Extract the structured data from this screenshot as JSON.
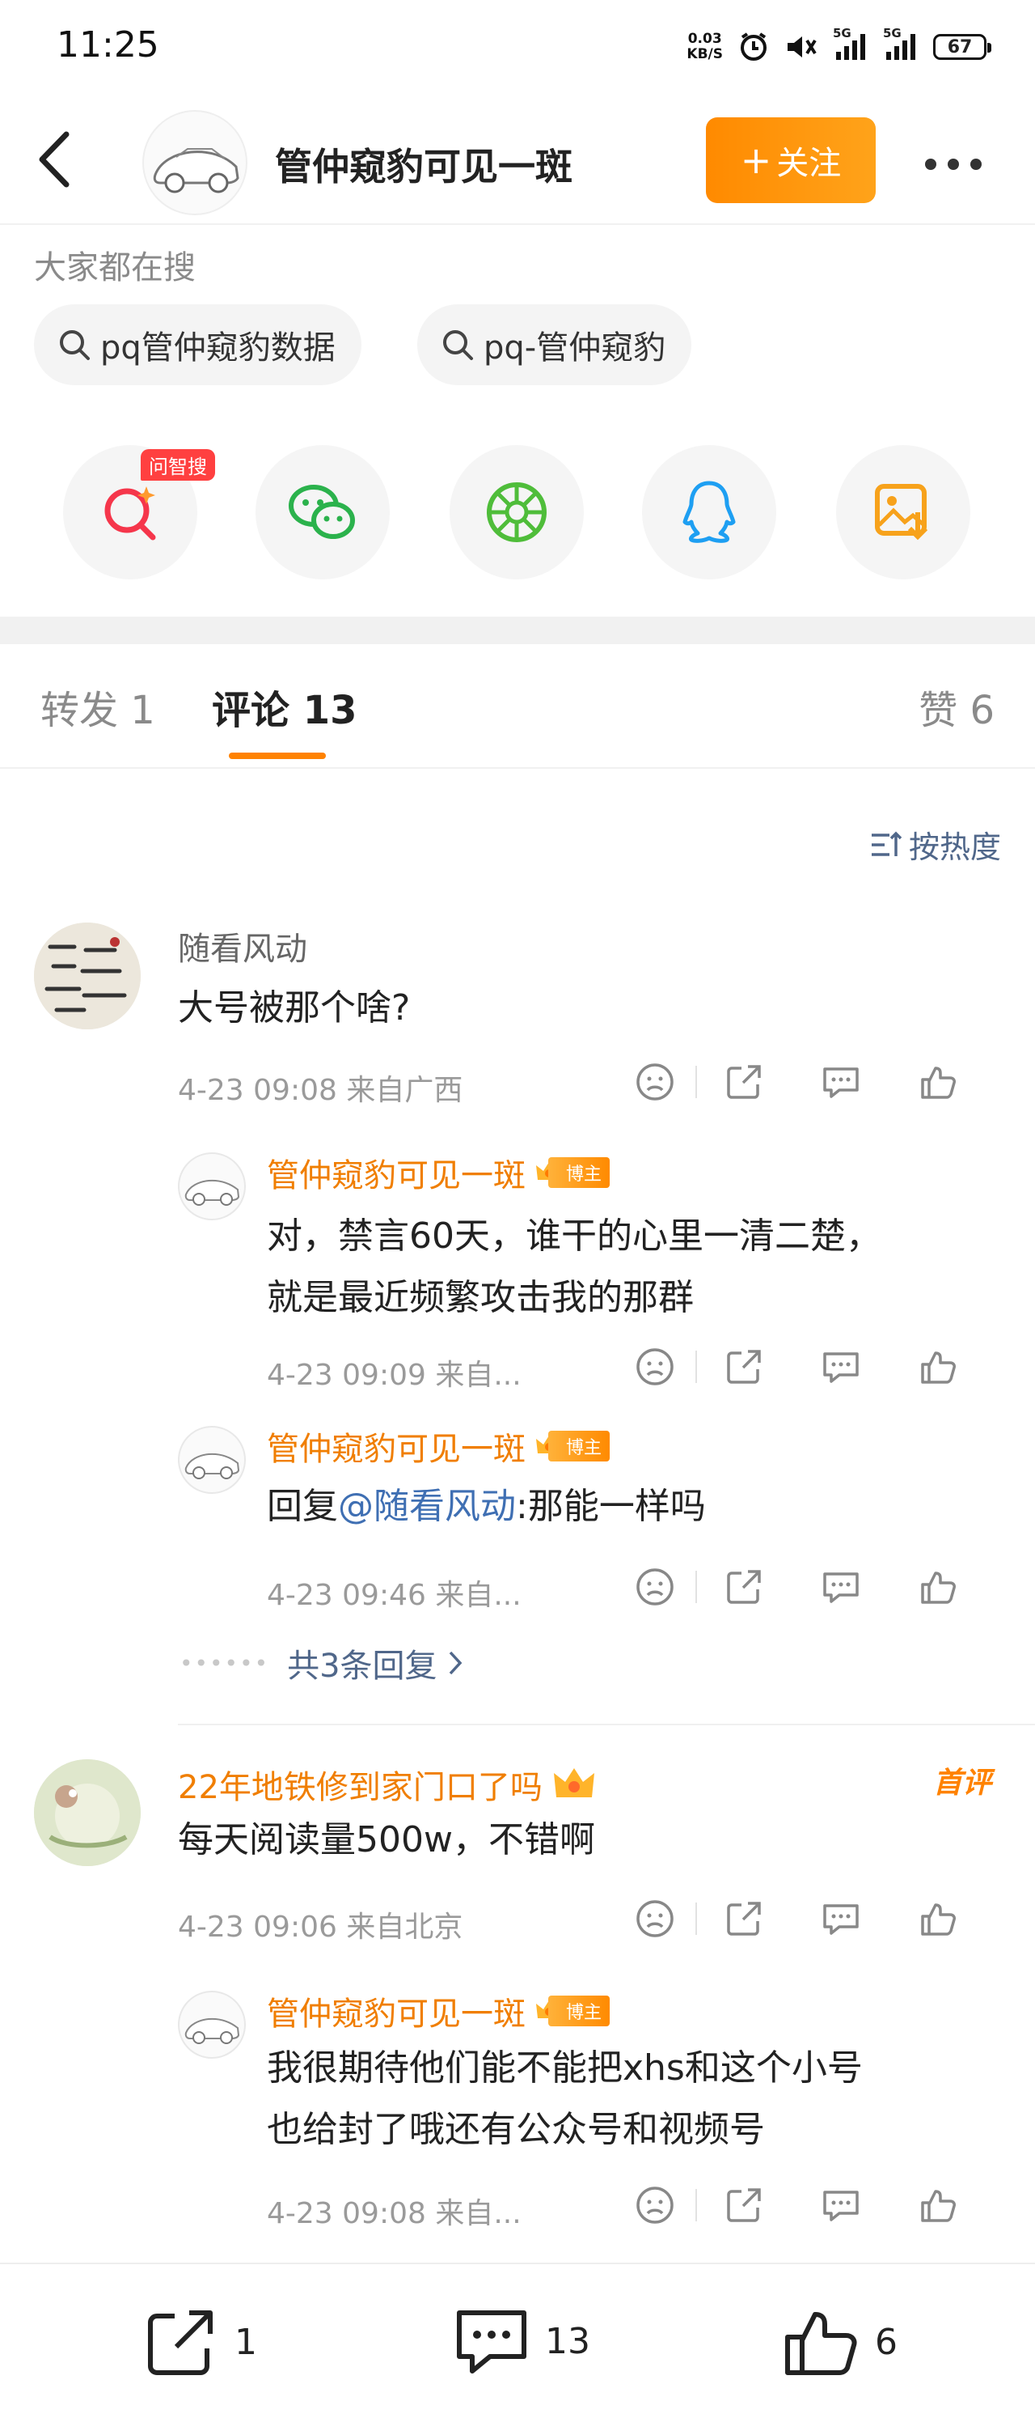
{
  "status_bar": {
    "time": "11:25",
    "net_speed_top": "0.03",
    "net_speed_unit": "KB/S",
    "signal_1": "5G",
    "signal_2": "5G",
    "battery": "67"
  },
  "header": {
    "title": "管仲窥豹可见一斑",
    "follow_label": "关注"
  },
  "search": {
    "title": "大家都在搜",
    "chips": [
      "pq管仲窥豹数据",
      "pq-管仲窥豹"
    ]
  },
  "share": {
    "ai_badge": "问智搜",
    "icons": [
      "ai-search-icon",
      "wechat-icon",
      "moments-icon",
      "qq-icon",
      "save-image-icon"
    ]
  },
  "tabs": {
    "repost": "转发 1",
    "comments": "评论 13",
    "likes": "赞 6"
  },
  "sort_label": "按热度",
  "comments": [
    {
      "user": "随看风动",
      "text": "大号被那个啥?",
      "meta": "4-23 09:08  来自广西",
      "replies": [
        {
          "user": "管仲窥豹可见一斑",
          "badge": "博主",
          "text_line1": "对，禁言60天，谁干的心里一清二楚，",
          "text_line2": "就是最近频繁攻击我的那群",
          "meta": "4-23 09:09  来自..."
        },
        {
          "user": "管仲窥豹可见一斑",
          "badge": "博主",
          "text_prefix": "回复",
          "mention": "@随看风动",
          "text_suffix": ":那能一样吗",
          "meta": "4-23 09:46  来自..."
        }
      ],
      "more_replies": "共3条回复"
    },
    {
      "user": "22年地铁修到家门口了吗",
      "first_badge": "首评",
      "text": "每天阅读量500w，不错啊",
      "meta": "4-23 09:06  来自北京",
      "replies": [
        {
          "user": "管仲窥豹可见一斑",
          "badge": "博主",
          "text_line1": "我很期待他们能不能把xhs和这个小号",
          "text_line2": "也给封了哦还有公众号和视频号",
          "meta": "4-23 09:08  来自..."
        }
      ]
    }
  ],
  "bottom_bar": {
    "repost_count": "1",
    "comment_count": "13",
    "like_count": "6"
  },
  "colors": {
    "accent": "#ff8200",
    "link": "#50678a",
    "orange_name": "#f07e00"
  }
}
